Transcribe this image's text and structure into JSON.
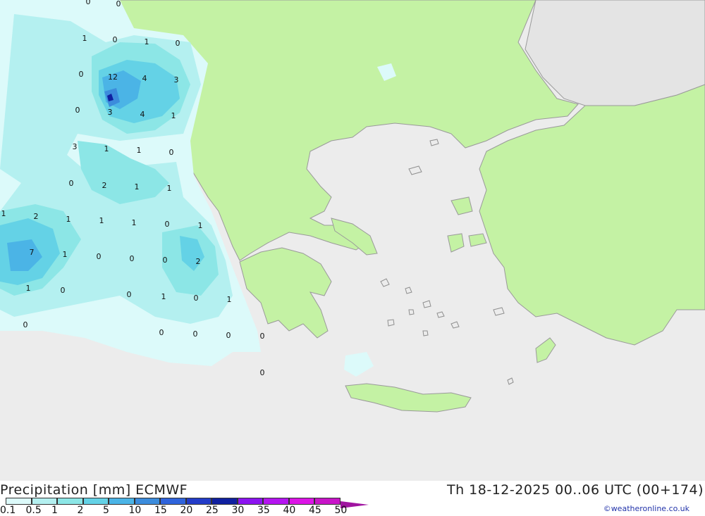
{
  "header": {
    "title": "Precipitation [mm] ECMWF",
    "datetime": "Th 18-12-2025 00..06 UTC (00+174)",
    "credit": "©weatheronline.co.uk"
  },
  "legend": {
    "levels": [
      "0.1",
      "0.5",
      "1",
      "2",
      "5",
      "10",
      "15",
      "20",
      "25",
      "30",
      "35",
      "40",
      "45",
      "50"
    ],
    "colors": [
      "#dcfafa",
      "#b4f0f0",
      "#8ce6e6",
      "#64d2e6",
      "#4bb4e6",
      "#3c8cdc",
      "#2f64dc",
      "#233cc8",
      "#1020a0",
      "#8c14f0",
      "#b414f0",
      "#dc14e6",
      "#c814c8",
      "#a014a0"
    ]
  },
  "colors": {
    "sea": "#ececec",
    "land": "#c4f2a4",
    "outside": "#e4e4e4",
    "border": "#8f8f8f"
  },
  "map_values": [
    {
      "v": "0"
    },
    {
      "v": "0"
    },
    {
      "v": "1"
    },
    {
      "v": "0"
    },
    {
      "v": "1"
    },
    {
      "v": "0"
    },
    {
      "v": "0"
    },
    {
      "v": "12"
    },
    {
      "v": "4"
    },
    {
      "v": "3"
    },
    {
      "v": "0"
    },
    {
      "v": "3"
    },
    {
      "v": "4"
    },
    {
      "v": "1"
    },
    {
      "v": "3"
    },
    {
      "v": "1"
    },
    {
      "v": "1"
    },
    {
      "v": "0"
    },
    {
      "v": "0"
    },
    {
      "v": "2"
    },
    {
      "v": "1"
    },
    {
      "v": "1"
    },
    {
      "v": "1"
    },
    {
      "v": "2"
    },
    {
      "v": "1"
    },
    {
      "v": "1"
    },
    {
      "v": "1"
    },
    {
      "v": "0"
    },
    {
      "v": "1"
    },
    {
      "v": "7"
    },
    {
      "v": "1"
    },
    {
      "v": "0"
    },
    {
      "v": "0"
    },
    {
      "v": "0"
    },
    {
      "v": "2"
    },
    {
      "v": "1"
    },
    {
      "v": "0"
    },
    {
      "v": "0"
    },
    {
      "v": "1"
    },
    {
      "v": "0"
    },
    {
      "v": "1"
    },
    {
      "v": "0"
    },
    {
      "v": "0"
    },
    {
      "v": "0"
    },
    {
      "v": "0"
    },
    {
      "v": "0"
    },
    {
      "v": "0"
    },
    {
      "v": "0"
    }
  ]
}
